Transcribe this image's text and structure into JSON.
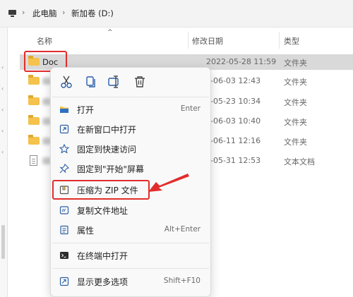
{
  "breadcrumb": {
    "items": [
      "此电脑",
      "新加卷 (D:)"
    ],
    "separator": "›"
  },
  "columns": {
    "name": "名称",
    "modified": "修改日期",
    "type": "类型"
  },
  "rows": [
    {
      "name": "Doc",
      "date": "2022-05-28 11:59",
      "type": "文件夹",
      "icon": "folder-icon",
      "selected": true
    },
    {
      "name": "",
      "date": "-06-03 12:43",
      "type": "文件夹",
      "icon": "folder-icon"
    },
    {
      "name": "",
      "date": "-05-23 10:34",
      "type": "文件夹",
      "icon": "folder-icon"
    },
    {
      "name": "",
      "date": "-06-03 10:40",
      "type": "文件夹",
      "icon": "folder-icon"
    },
    {
      "name": "",
      "date": "-06-11 12:16",
      "type": "文件夹",
      "icon": "folder-icon"
    },
    {
      "name": "",
      "date": "-05-31 12:53",
      "type": "文本文档",
      "icon": "text-document-icon"
    }
  ],
  "context_menu": {
    "toolbar": [
      "cut-icon",
      "copy-icon",
      "rename-icon",
      "delete-icon"
    ],
    "items": [
      {
        "label": "打开",
        "shortcut": "Enter",
        "icon": "open-folder-icon"
      },
      {
        "label": "在新窗口中打开",
        "shortcut": "",
        "icon": "new-window-icon"
      },
      {
        "label": "固定到快速访问",
        "shortcut": "",
        "icon": "star-icon"
      },
      {
        "label": "固定到\"开始\"屏幕",
        "shortcut": "",
        "icon": "pin-icon"
      },
      {
        "label": "压缩为 ZIP 文件",
        "shortcut": "",
        "icon": "zip-icon"
      },
      {
        "label": "复制文件地址",
        "shortcut": "",
        "icon": "copy-path-icon"
      },
      {
        "label": "属性",
        "shortcut": "Alt+Enter",
        "icon": "properties-icon"
      },
      {
        "label": "在终端中打开",
        "shortcut": "",
        "icon": "terminal-icon"
      },
      {
        "label": "显示更多选项",
        "shortcut": "Shift+F10",
        "icon": "more-options-icon"
      }
    ]
  },
  "colors": {
    "highlight": "#e12d2d",
    "accent": "#0067c0",
    "folder": "#f5c24b"
  }
}
